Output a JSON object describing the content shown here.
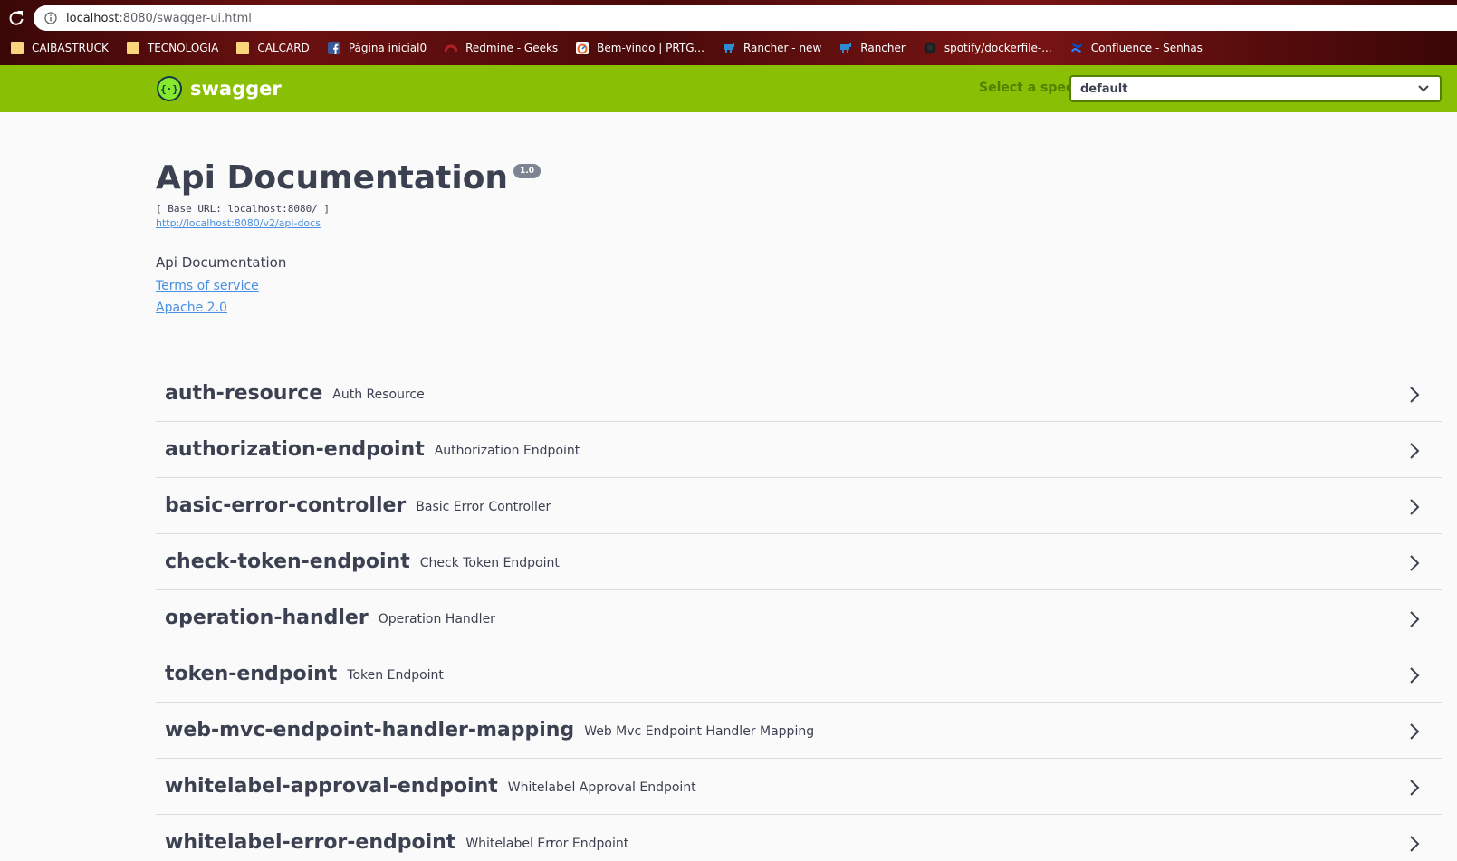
{
  "browser": {
    "url_host": "localhost",
    "url_path": ":8080/swagger-ui.html",
    "bookmarks": [
      {
        "label": "CAIBASTRUCK",
        "icon": "folder-icon"
      },
      {
        "label": "TECNOLOGIA",
        "icon": "folder-icon"
      },
      {
        "label": "CALCARD",
        "icon": "folder-icon"
      },
      {
        "label": "Página inicial0",
        "icon": "facebook-icon"
      },
      {
        "label": "Redmine - Geeks",
        "icon": "redmine-icon"
      },
      {
        "label": "Bem-vindo | PRTG...",
        "icon": "prtg-icon"
      },
      {
        "label": "Rancher - new",
        "icon": "rancher-icon"
      },
      {
        "label": "Rancher",
        "icon": "rancher-icon"
      },
      {
        "label": "spotify/dockerfile-...",
        "icon": "github-icon"
      },
      {
        "label": "Confluence - Senhas",
        "icon": "confluence-icon"
      }
    ]
  },
  "topbar": {
    "logo_text": "swagger",
    "spec_label": "Select a spec",
    "spec_value": "default",
    "brand_color": "#89bf04"
  },
  "info": {
    "title": "Api Documentation",
    "version": "1.0",
    "base_url": "[ Base URL: localhost:8080/ ]",
    "api_docs_url": "http://localhost:8080/v2/api-docs",
    "description": "Api Documentation",
    "terms": "Terms of service",
    "license": "Apache 2.0"
  },
  "tags": [
    {
      "name": "auth-resource",
      "description": "Auth Resource"
    },
    {
      "name": "authorization-endpoint",
      "description": "Authorization Endpoint"
    },
    {
      "name": "basic-error-controller",
      "description": "Basic Error Controller"
    },
    {
      "name": "check-token-endpoint",
      "description": "Check Token Endpoint"
    },
    {
      "name": "operation-handler",
      "description": "Operation Handler"
    },
    {
      "name": "token-endpoint",
      "description": "Token Endpoint"
    },
    {
      "name": "web-mvc-endpoint-handler-mapping",
      "description": "Web Mvc Endpoint Handler Mapping"
    },
    {
      "name": "whitelabel-approval-endpoint",
      "description": "Whitelabel Approval Endpoint"
    },
    {
      "name": "whitelabel-error-endpoint",
      "description": "Whitelabel Error Endpoint"
    }
  ]
}
